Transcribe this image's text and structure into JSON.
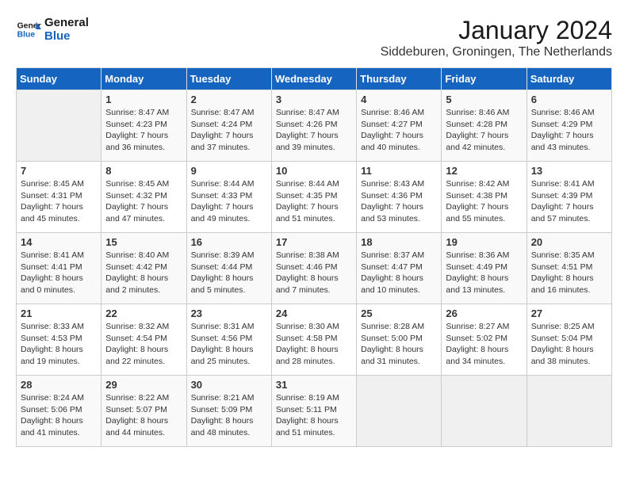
{
  "header": {
    "logo_general": "General",
    "logo_blue": "Blue",
    "month": "January 2024",
    "location": "Siddeburen, Groningen, The Netherlands"
  },
  "days_of_week": [
    "Sunday",
    "Monday",
    "Tuesday",
    "Wednesday",
    "Thursday",
    "Friday",
    "Saturday"
  ],
  "weeks": [
    [
      {
        "day": "",
        "info": ""
      },
      {
        "day": "1",
        "info": "Sunrise: 8:47 AM\nSunset: 4:23 PM\nDaylight: 7 hours\nand 36 minutes."
      },
      {
        "day": "2",
        "info": "Sunrise: 8:47 AM\nSunset: 4:24 PM\nDaylight: 7 hours\nand 37 minutes."
      },
      {
        "day": "3",
        "info": "Sunrise: 8:47 AM\nSunset: 4:26 PM\nDaylight: 7 hours\nand 39 minutes."
      },
      {
        "day": "4",
        "info": "Sunrise: 8:46 AM\nSunset: 4:27 PM\nDaylight: 7 hours\nand 40 minutes."
      },
      {
        "day": "5",
        "info": "Sunrise: 8:46 AM\nSunset: 4:28 PM\nDaylight: 7 hours\nand 42 minutes."
      },
      {
        "day": "6",
        "info": "Sunrise: 8:46 AM\nSunset: 4:29 PM\nDaylight: 7 hours\nand 43 minutes."
      }
    ],
    [
      {
        "day": "7",
        "info": "Sunrise: 8:45 AM\nSunset: 4:31 PM\nDaylight: 7 hours\nand 45 minutes."
      },
      {
        "day": "8",
        "info": "Sunrise: 8:45 AM\nSunset: 4:32 PM\nDaylight: 7 hours\nand 47 minutes."
      },
      {
        "day": "9",
        "info": "Sunrise: 8:44 AM\nSunset: 4:33 PM\nDaylight: 7 hours\nand 49 minutes."
      },
      {
        "day": "10",
        "info": "Sunrise: 8:44 AM\nSunset: 4:35 PM\nDaylight: 7 hours\nand 51 minutes."
      },
      {
        "day": "11",
        "info": "Sunrise: 8:43 AM\nSunset: 4:36 PM\nDaylight: 7 hours\nand 53 minutes."
      },
      {
        "day": "12",
        "info": "Sunrise: 8:42 AM\nSunset: 4:38 PM\nDaylight: 7 hours\nand 55 minutes."
      },
      {
        "day": "13",
        "info": "Sunrise: 8:41 AM\nSunset: 4:39 PM\nDaylight: 7 hours\nand 57 minutes."
      }
    ],
    [
      {
        "day": "14",
        "info": "Sunrise: 8:41 AM\nSunset: 4:41 PM\nDaylight: 8 hours\nand 0 minutes."
      },
      {
        "day": "15",
        "info": "Sunrise: 8:40 AM\nSunset: 4:42 PM\nDaylight: 8 hours\nand 2 minutes."
      },
      {
        "day": "16",
        "info": "Sunrise: 8:39 AM\nSunset: 4:44 PM\nDaylight: 8 hours\nand 5 minutes."
      },
      {
        "day": "17",
        "info": "Sunrise: 8:38 AM\nSunset: 4:46 PM\nDaylight: 8 hours\nand 7 minutes."
      },
      {
        "day": "18",
        "info": "Sunrise: 8:37 AM\nSunset: 4:47 PM\nDaylight: 8 hours\nand 10 minutes."
      },
      {
        "day": "19",
        "info": "Sunrise: 8:36 AM\nSunset: 4:49 PM\nDaylight: 8 hours\nand 13 minutes."
      },
      {
        "day": "20",
        "info": "Sunrise: 8:35 AM\nSunset: 4:51 PM\nDaylight: 8 hours\nand 16 minutes."
      }
    ],
    [
      {
        "day": "21",
        "info": "Sunrise: 8:33 AM\nSunset: 4:53 PM\nDaylight: 8 hours\nand 19 minutes."
      },
      {
        "day": "22",
        "info": "Sunrise: 8:32 AM\nSunset: 4:54 PM\nDaylight: 8 hours\nand 22 minutes."
      },
      {
        "day": "23",
        "info": "Sunrise: 8:31 AM\nSunset: 4:56 PM\nDaylight: 8 hours\nand 25 minutes."
      },
      {
        "day": "24",
        "info": "Sunrise: 8:30 AM\nSunset: 4:58 PM\nDaylight: 8 hours\nand 28 minutes."
      },
      {
        "day": "25",
        "info": "Sunrise: 8:28 AM\nSunset: 5:00 PM\nDaylight: 8 hours\nand 31 minutes."
      },
      {
        "day": "26",
        "info": "Sunrise: 8:27 AM\nSunset: 5:02 PM\nDaylight: 8 hours\nand 34 minutes."
      },
      {
        "day": "27",
        "info": "Sunrise: 8:25 AM\nSunset: 5:04 PM\nDaylight: 8 hours\nand 38 minutes."
      }
    ],
    [
      {
        "day": "28",
        "info": "Sunrise: 8:24 AM\nSunset: 5:06 PM\nDaylight: 8 hours\nand 41 minutes."
      },
      {
        "day": "29",
        "info": "Sunrise: 8:22 AM\nSunset: 5:07 PM\nDaylight: 8 hours\nand 44 minutes."
      },
      {
        "day": "30",
        "info": "Sunrise: 8:21 AM\nSunset: 5:09 PM\nDaylight: 8 hours\nand 48 minutes."
      },
      {
        "day": "31",
        "info": "Sunrise: 8:19 AM\nSunset: 5:11 PM\nDaylight: 8 hours\nand 51 minutes."
      },
      {
        "day": "",
        "info": ""
      },
      {
        "day": "",
        "info": ""
      },
      {
        "day": "",
        "info": ""
      }
    ]
  ]
}
